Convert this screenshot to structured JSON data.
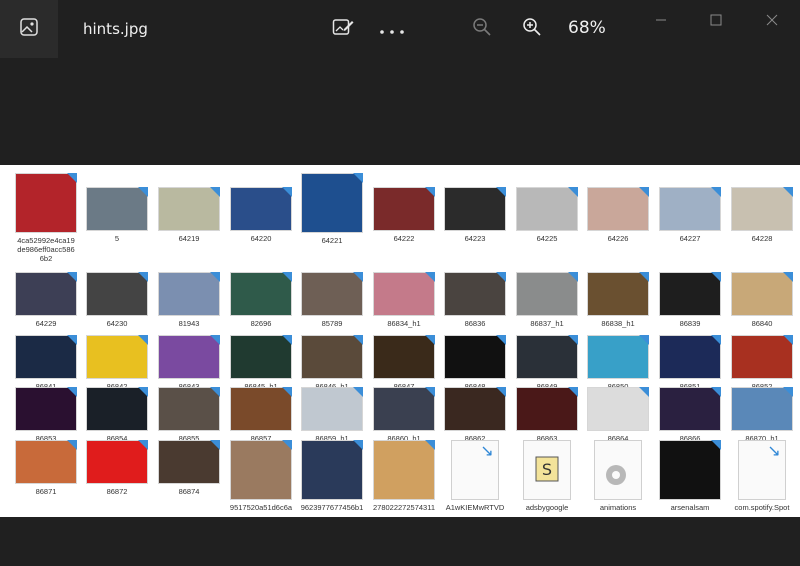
{
  "window": {
    "filename": "hints.jpg",
    "zoom_label": "68%"
  },
  "icons": {
    "app": "photo-app-icon",
    "edit": "edit-image-icon",
    "more": "more-icon",
    "zoom_out": "zoom-out-icon",
    "zoom_in": "zoom-in-icon",
    "minimize": "minimize-icon",
    "maximize": "maximize-icon",
    "close": "close-icon"
  },
  "thumbnails": [
    {
      "caption": "4ca52992e4ca19de986eff0acc5866b2",
      "color": "#b3242a"
    },
    {
      "caption": "5",
      "color": "#6b7a86"
    },
    {
      "caption": "64219",
      "color": "#b9b9a0"
    },
    {
      "caption": "64220",
      "color": "#2a4e8a"
    },
    {
      "caption": "64221",
      "color": "#1e4f8f"
    },
    {
      "caption": "64222",
      "color": "#7a2a2a"
    },
    {
      "caption": "64223",
      "color": "#2b2b2b"
    },
    {
      "caption": "64225",
      "color": "#b8b8b8"
    },
    {
      "caption": "64226",
      "color": "#c9a79a"
    },
    {
      "caption": "64227",
      "color": "#9fb0c5"
    },
    {
      "caption": "64228",
      "color": "#c8c0b0"
    },
    {
      "caption": "64229",
      "color": "#3d3f55"
    },
    {
      "caption": "64230",
      "color": "#444444"
    },
    {
      "caption": "81943",
      "color": "#7b8fb0"
    },
    {
      "caption": "82696",
      "color": "#2f5a4a"
    },
    {
      "caption": "85789",
      "color": "#6e5f55"
    },
    {
      "caption": "86834_h1",
      "color": "#c47a8a"
    },
    {
      "caption": "86836",
      "color": "#4a4440"
    },
    {
      "caption": "86837_h1",
      "color": "#8a8c8c"
    },
    {
      "caption": "86838_h1",
      "color": "#6a5030"
    },
    {
      "caption": "86839",
      "color": "#1e1e1e"
    },
    {
      "caption": "86840",
      "color": "#c8a878"
    },
    {
      "caption": "86841",
      "color": "#1b2a45"
    },
    {
      "caption": "86842",
      "color": "#e8c020"
    },
    {
      "caption": "86843",
      "color": "#7a4aa0"
    },
    {
      "caption": "86845_h1",
      "color": "#203a30"
    },
    {
      "caption": "86846_h1",
      "color": "#5a4a3a"
    },
    {
      "caption": "86847",
      "color": "#3a2a1a"
    },
    {
      "caption": "86848",
      "color": "#111111"
    },
    {
      "caption": "86849",
      "color": "#2a3038"
    },
    {
      "caption": "86850",
      "color": "#38a0c8"
    },
    {
      "caption": "86851",
      "color": "#1c2a58"
    },
    {
      "caption": "86852",
      "color": "#a83020"
    },
    {
      "caption": "86853",
      "color": "#2a1030"
    },
    {
      "caption": "86854",
      "color": "#1a2028"
    },
    {
      "caption": "86855",
      "color": "#5a5048"
    },
    {
      "caption": "86857",
      "color": "#7a4a2a"
    },
    {
      "caption": "86859_h1",
      "color": "#c0c8d0"
    },
    {
      "caption": "86860_h1",
      "color": "#3a4050"
    },
    {
      "caption": "86862",
      "color": "#3a2820"
    },
    {
      "caption": "86863",
      "color": "#4a1818"
    },
    {
      "caption": "86864",
      "color": "#dcdcdc"
    },
    {
      "caption": "86866",
      "color": "#2a2040"
    },
    {
      "caption": "86870_h1",
      "color": "#5a88b8"
    },
    {
      "caption": "86871",
      "color": "#c86a3a"
    },
    {
      "caption": "86872",
      "color": "#e01c1c"
    },
    {
      "caption": "86874",
      "color": "#4a3a30"
    },
    {
      "caption": "9517520a51d6c6a",
      "color": "#9a7a60"
    },
    {
      "caption": "9623977677456b1",
      "color": "#2a3a5a"
    },
    {
      "caption": "278022272574311",
      "color": "#d0a060"
    },
    {
      "caption": "A1wKIEMwRTVD",
      "color": "file"
    },
    {
      "caption": "adsbygoogle",
      "color": "file-s"
    },
    {
      "caption": "animations",
      "color": "file-gear"
    },
    {
      "caption": "arsenalsam",
      "color": "#111111"
    },
    {
      "caption": "com.spotify.Spot",
      "color": "file"
    }
  ]
}
